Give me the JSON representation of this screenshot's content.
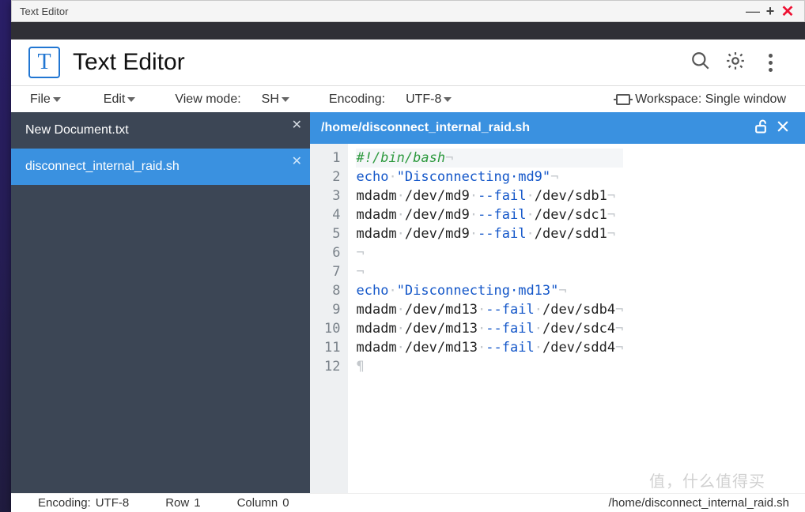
{
  "window": {
    "title": "Text Editor"
  },
  "app": {
    "icon_glyph": "T",
    "title": "Text Editor"
  },
  "menubar": {
    "file": "File",
    "edit": "Edit",
    "viewmode_label": "View mode:",
    "viewmode_value": "SH",
    "encoding_label": "Encoding:",
    "encoding_value": "UTF-8",
    "workspace_label": "Workspace: Single window"
  },
  "sidebar": {
    "items": [
      {
        "label": "New Document.txt",
        "active": false
      },
      {
        "label": "disconnect_internal_raid.sh",
        "active": true
      }
    ]
  },
  "editor": {
    "path": "/home/disconnect_internal_raid.sh",
    "lines": [
      {
        "n": 1,
        "tokens": [
          {
            "t": "#!/bin/bash",
            "c": "cm"
          },
          {
            "t": "¬",
            "c": "ws"
          }
        ]
      },
      {
        "n": 2,
        "tokens": [
          {
            "t": "echo",
            "c": "kw"
          },
          {
            "t": "·",
            "c": "ws"
          },
          {
            "t": "\"Disconnecting·md9\"",
            "c": "str"
          },
          {
            "t": "¬",
            "c": "ws"
          }
        ]
      },
      {
        "n": 3,
        "tokens": [
          {
            "t": "mdadm",
            "c": "id"
          },
          {
            "t": "·",
            "c": "ws"
          },
          {
            "t": "/dev/md9",
            "c": "id"
          },
          {
            "t": "·",
            "c": "ws"
          },
          {
            "t": "--",
            "c": "op"
          },
          {
            "t": "fail",
            "c": "kw"
          },
          {
            "t": "·",
            "c": "ws"
          },
          {
            "t": "/dev/sdb1",
            "c": "id"
          },
          {
            "t": "¬",
            "c": "ws"
          }
        ]
      },
      {
        "n": 4,
        "tokens": [
          {
            "t": "mdadm",
            "c": "id"
          },
          {
            "t": "·",
            "c": "ws"
          },
          {
            "t": "/dev/md9",
            "c": "id"
          },
          {
            "t": "·",
            "c": "ws"
          },
          {
            "t": "--",
            "c": "op"
          },
          {
            "t": "fail",
            "c": "kw"
          },
          {
            "t": "·",
            "c": "ws"
          },
          {
            "t": "/dev/sdc1",
            "c": "id"
          },
          {
            "t": "¬",
            "c": "ws"
          }
        ]
      },
      {
        "n": 5,
        "tokens": [
          {
            "t": "mdadm",
            "c": "id"
          },
          {
            "t": "·",
            "c": "ws"
          },
          {
            "t": "/dev/md9",
            "c": "id"
          },
          {
            "t": "·",
            "c": "ws"
          },
          {
            "t": "--",
            "c": "op"
          },
          {
            "t": "fail",
            "c": "kw"
          },
          {
            "t": "·",
            "c": "ws"
          },
          {
            "t": "/dev/sdd1",
            "c": "id"
          },
          {
            "t": "¬",
            "c": "ws"
          }
        ]
      },
      {
        "n": 6,
        "tokens": [
          {
            "t": "¬",
            "c": "ws"
          }
        ]
      },
      {
        "n": 7,
        "tokens": [
          {
            "t": "¬",
            "c": "ws"
          }
        ]
      },
      {
        "n": 8,
        "tokens": [
          {
            "t": "echo",
            "c": "kw"
          },
          {
            "t": "·",
            "c": "ws"
          },
          {
            "t": "\"Disconnecting·md13\"",
            "c": "str"
          },
          {
            "t": "¬",
            "c": "ws"
          }
        ]
      },
      {
        "n": 9,
        "tokens": [
          {
            "t": "mdadm",
            "c": "id"
          },
          {
            "t": "·",
            "c": "ws"
          },
          {
            "t": "/dev/md13",
            "c": "id"
          },
          {
            "t": "·",
            "c": "ws"
          },
          {
            "t": "--",
            "c": "op"
          },
          {
            "t": "fail",
            "c": "kw"
          },
          {
            "t": "·",
            "c": "ws"
          },
          {
            "t": "/dev/sdb4",
            "c": "id"
          },
          {
            "t": "¬",
            "c": "ws"
          }
        ]
      },
      {
        "n": 10,
        "tokens": [
          {
            "t": "mdadm",
            "c": "id"
          },
          {
            "t": "·",
            "c": "ws"
          },
          {
            "t": "/dev/md13",
            "c": "id"
          },
          {
            "t": "·",
            "c": "ws"
          },
          {
            "t": "--",
            "c": "op"
          },
          {
            "t": "fail",
            "c": "kw"
          },
          {
            "t": "·",
            "c": "ws"
          },
          {
            "t": "/dev/sdc4",
            "c": "id"
          },
          {
            "t": "¬",
            "c": "ws"
          }
        ]
      },
      {
        "n": 11,
        "tokens": [
          {
            "t": "mdadm",
            "c": "id"
          },
          {
            "t": "·",
            "c": "ws"
          },
          {
            "t": "/dev/md13",
            "c": "id"
          },
          {
            "t": "·",
            "c": "ws"
          },
          {
            "t": "--",
            "c": "op"
          },
          {
            "t": "fail",
            "c": "kw"
          },
          {
            "t": "·",
            "c": "ws"
          },
          {
            "t": "/dev/sdd4",
            "c": "id"
          },
          {
            "t": "¬",
            "c": "ws"
          }
        ]
      },
      {
        "n": 12,
        "tokens": [
          {
            "t": "¶",
            "c": "ws"
          }
        ]
      }
    ]
  },
  "statusbar": {
    "encoding_label": "Encoding:",
    "encoding_value": "UTF-8",
    "row_label": "Row",
    "row_value": "1",
    "col_label": "Column",
    "col_value": "0",
    "filepath": "/home/disconnect_internal_raid.sh"
  },
  "watermark": "值，什么值得买"
}
